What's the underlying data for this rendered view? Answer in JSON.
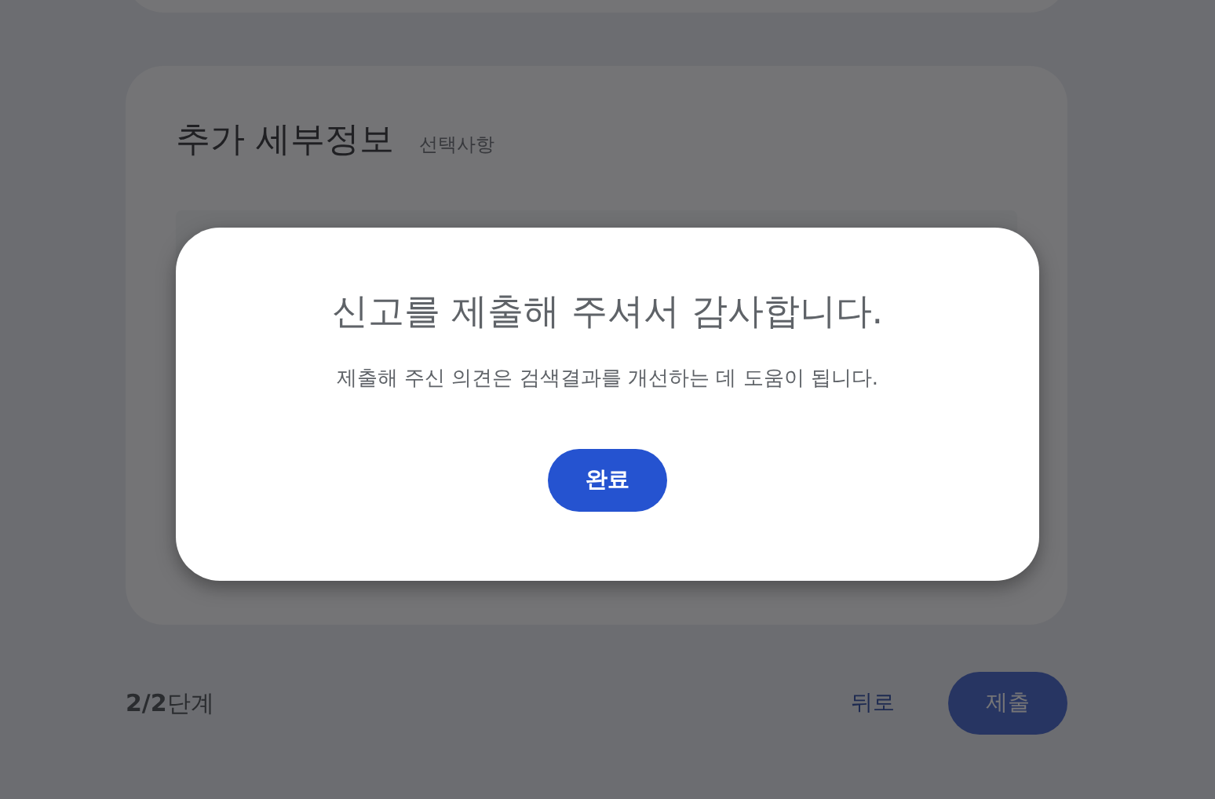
{
  "details_card": {
    "title": "추가 세부정보",
    "optional_label": "선택사항"
  },
  "footer": {
    "step": "**2/2**단계",
    "back_button": "뒤로",
    "submit_button": "제출"
  },
  "dialog": {
    "title": "신고를 제출해 주셔서 감사합니다.",
    "message": "제출해 주신 의견은 검색결과를 개선하는 데 도움이 됩니다.",
    "done_button": "완료"
  }
}
